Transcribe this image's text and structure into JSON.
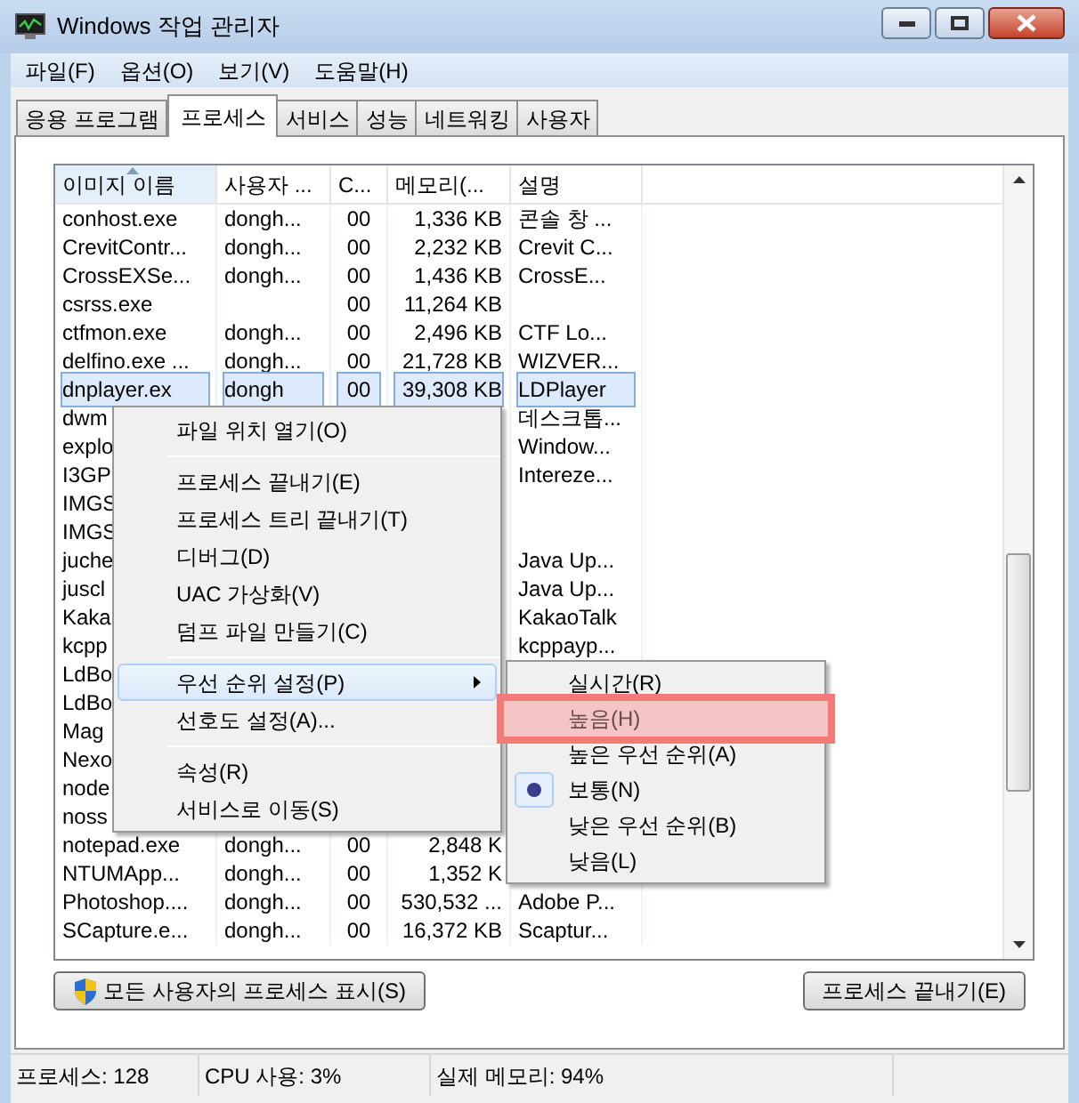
{
  "window": {
    "title": "Windows 작업 관리자"
  },
  "menu_bar": [
    "파일(F)",
    "옵션(O)",
    "보기(V)",
    "도움말(H)"
  ],
  "tabs": [
    {
      "label": "응용 프로그램",
      "selected": false
    },
    {
      "label": "프로세스",
      "selected": true
    },
    {
      "label": "서비스",
      "selected": false
    },
    {
      "label": "성능",
      "selected": false
    },
    {
      "label": "네트워킹",
      "selected": false
    },
    {
      "label": "사용자",
      "selected": false
    }
  ],
  "process_table": {
    "columns": [
      {
        "label": "이미지 이름",
        "sorted": true
      },
      {
        "label": "사용자 ...",
        "sorted": false
      },
      {
        "label": "C...",
        "sorted": false
      },
      {
        "label": "메모리(...",
        "sorted": false
      },
      {
        "label": "설명",
        "sorted": false
      }
    ],
    "rows": [
      {
        "name": "conhost.exe",
        "user": "dongh...",
        "cpu": "00",
        "memory": "1,336 KB",
        "description": "콘솔 창 ...",
        "selected": false
      },
      {
        "name": "CrevitContr...",
        "user": "dongh...",
        "cpu": "00",
        "memory": "2,232 KB",
        "description": "Crevit C...",
        "selected": false
      },
      {
        "name": "CrossEXSe...",
        "user": "dongh...",
        "cpu": "00",
        "memory": "1,436 KB",
        "description": "CrossE...",
        "selected": false
      },
      {
        "name": "csrss.exe",
        "cpu": "00",
        "memory": "11,264 KB",
        "selected": false
      },
      {
        "name": "ctfmon.exe",
        "user": "dongh...",
        "cpu": "00",
        "memory": "2,496 KB",
        "description": "CTF Lo...",
        "selected": false
      },
      {
        "name": "delfino.exe ...",
        "user": "dongh...",
        "cpu": "00",
        "memory": "21,728 KB",
        "description": "WIZVER...",
        "selected": false
      },
      {
        "name": "dnplayer.ex",
        "user": "dongh",
        "cpu": "00",
        "memory": "39,308 KB",
        "description": "LDPlayer",
        "selected": true
      },
      {
        "name": "dwm",
        "description": "데스크톱...",
        "selected": false
      },
      {
        "name": "explo",
        "description": "Window...",
        "selected": false
      },
      {
        "name": "I3GP",
        "description": "Intereze...",
        "selected": false
      },
      {
        "name": "IMGS",
        "selected": false
      },
      {
        "name": "IMGS",
        "selected": false
      },
      {
        "name": "juche",
        "description": "Java Up...",
        "selected": false
      },
      {
        "name": "juscl",
        "description": "Java Up...",
        "selected": false
      },
      {
        "name": "Kaka",
        "description": "KakaoTalk",
        "selected": false
      },
      {
        "name": "kcpp",
        "description": "kcppayp...",
        "selected": false
      },
      {
        "name": "LdBo",
        "selected": false
      },
      {
        "name": "LdBo",
        "selected": false
      },
      {
        "name": "Mag",
        "selected": false
      },
      {
        "name": "Nexo",
        "selected": false
      },
      {
        "name": "node",
        "selected": false
      },
      {
        "name": "noss",
        "selected": false
      },
      {
        "name": "notepad.exe",
        "user": "dongh...",
        "cpu": "00",
        "memory": "2,848 K",
        "selected": false
      },
      {
        "name": "NTUMApp...",
        "user": "dongh...",
        "cpu": "00",
        "memory": "1,352 K",
        "selected": false
      },
      {
        "name": "Photoshop....",
        "user": "dongh...",
        "cpu": "00",
        "memory": "530,532 ...",
        "description": "Adobe P...",
        "selected": false
      },
      {
        "name": "SCapture.e...",
        "user": "dongh...",
        "cpu": "00",
        "memory": "16,372 KB",
        "description": "Scaptur...",
        "selected": false
      }
    ]
  },
  "context_menu": {
    "items": [
      {
        "kind": "item",
        "label": "파일 위치 열기(O)",
        "highlighted": false
      },
      {
        "kind": "separator"
      },
      {
        "kind": "item",
        "label": "프로세스 끝내기(E)",
        "highlighted": false
      },
      {
        "kind": "item",
        "label": "프로세스 트리 끝내기(T)",
        "highlighted": false
      },
      {
        "kind": "item",
        "label": "디버그(D)",
        "highlighted": false
      },
      {
        "kind": "item",
        "label": "UAC 가상화(V)",
        "highlighted": false
      },
      {
        "kind": "item",
        "label": "덤프 파일 만들기(C)",
        "highlighted": false
      },
      {
        "kind": "separator"
      },
      {
        "kind": "submenu",
        "label": "우선 순위 설정(P)",
        "highlighted": true
      },
      {
        "kind": "item",
        "label": "선호도 설정(A)...",
        "highlighted": false
      },
      {
        "kind": "separator"
      },
      {
        "kind": "item",
        "label": "속성(R)",
        "highlighted": false
      },
      {
        "kind": "item",
        "label": "서비스로 이동(S)",
        "highlighted": false
      }
    ]
  },
  "priority_menu": {
    "items": [
      {
        "label": "실시간(R)",
        "selected": false,
        "highlighted": false
      },
      {
        "label": "높음(H)",
        "selected": false,
        "highlighted": true
      },
      {
        "label": "높은 우선 순위(A)",
        "selected": false,
        "highlighted": false
      },
      {
        "label": "보통(N)",
        "selected": true,
        "highlighted": false
      },
      {
        "label": "낮은 우선 순위(B)",
        "selected": false,
        "highlighted": false
      },
      {
        "label": "낮음(L)",
        "selected": false,
        "highlighted": false
      }
    ]
  },
  "buttons": [
    {
      "label": "모든 사용자의 프로세스 표시(S)",
      "kind": "shield"
    },
    {
      "label": "프로세스 끝내기(E)",
      "kind": "plain"
    }
  ],
  "status_bar": [
    "프로세스: 128",
    "CPU 사용: 3%",
    "실제 메모리: 94%"
  ]
}
